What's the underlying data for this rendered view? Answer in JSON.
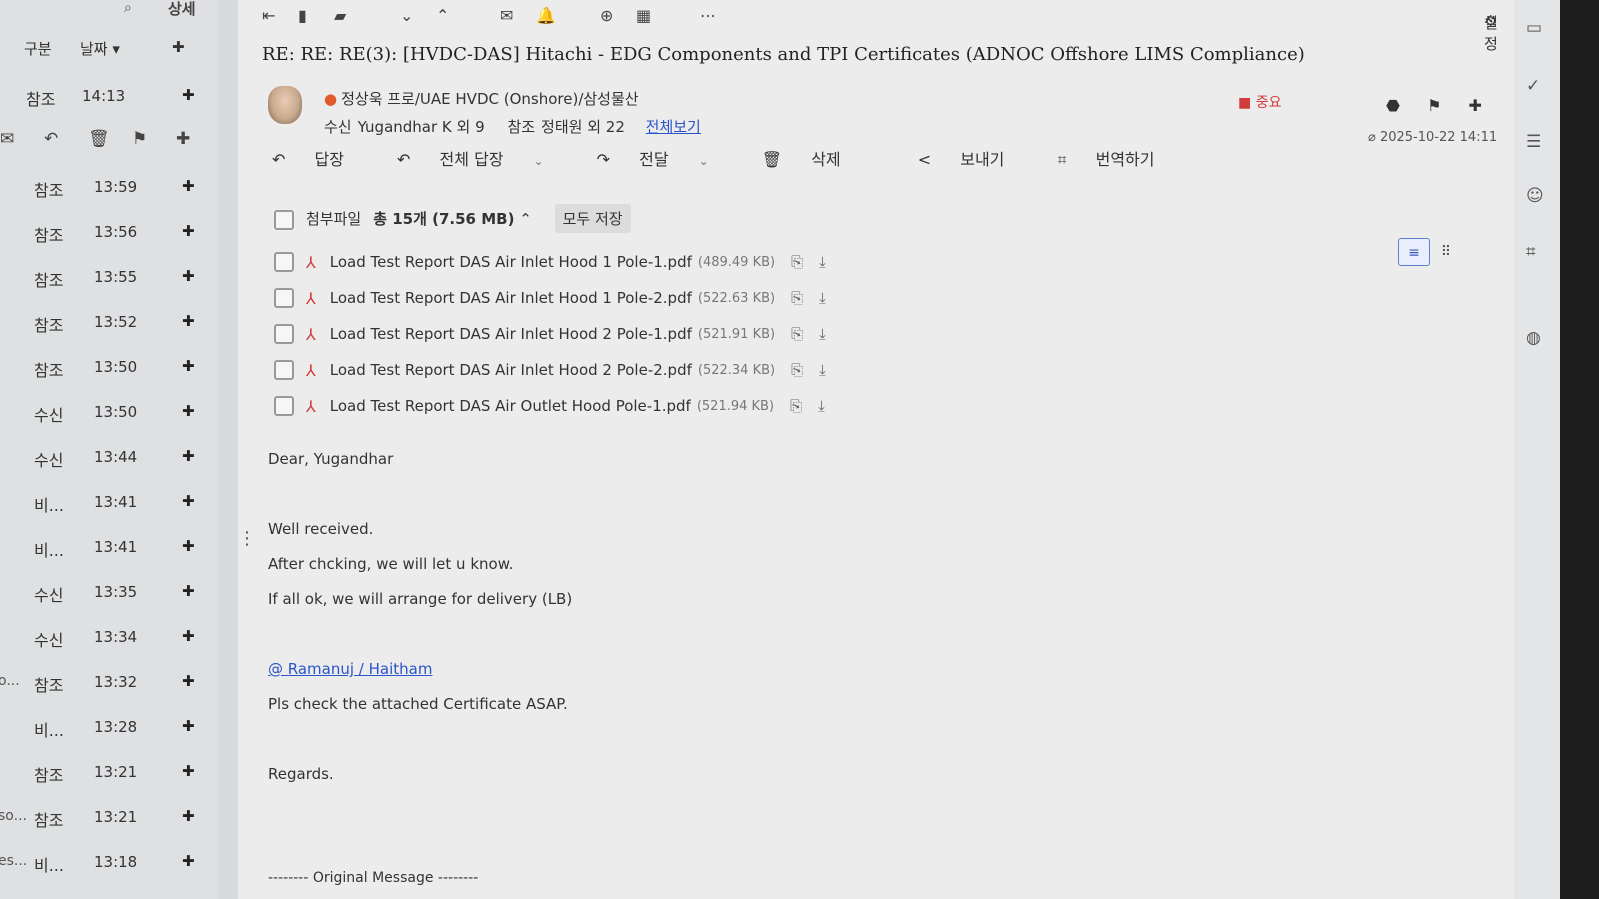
{
  "list": {
    "detail_label": "상세",
    "header": {
      "col_type": "구분",
      "col_date": "날짜",
      "sort_icon": "chevron-down"
    },
    "rows": [
      {
        "trunc": "",
        "type": "참조",
        "time": "14:13"
      },
      {
        "trunc": "",
        "type": "참조",
        "time": "13:59"
      },
      {
        "trunc": "",
        "type": "참조",
        "time": "13:56"
      },
      {
        "trunc": "",
        "type": "참조",
        "time": "13:55"
      },
      {
        "trunc": "",
        "type": "참조",
        "time": "13:52"
      },
      {
        "trunc": "",
        "type": "참조",
        "time": "13:50"
      },
      {
        "trunc": "",
        "type": "수신",
        "time": "13:50"
      },
      {
        "trunc": "",
        "type": "수신",
        "time": "13:44"
      },
      {
        "trunc": "",
        "type": "비...",
        "time": "13:41"
      },
      {
        "trunc": "",
        "type": "비...",
        "time": "13:41"
      },
      {
        "trunc": "",
        "type": "수신",
        "time": "13:35"
      },
      {
        "trunc": "",
        "type": "수신",
        "time": "13:34"
      },
      {
        "trunc": "o...",
        "type": "참조",
        "time": "13:32"
      },
      {
        "trunc": "",
        "type": "비...",
        "time": "13:28"
      },
      {
        "trunc": "",
        "type": "참조",
        "time": "13:21"
      },
      {
        "trunc": "so...",
        "type": "참조",
        "time": "13:21"
      },
      {
        "trunc": "es...",
        "type": "비...",
        "time": "13:18"
      }
    ]
  },
  "settings_label": "설정",
  "mail": {
    "subject": "RE: RE: RE(3): [HVDC-DAS] Hitachi - EDG Components and TPI Certificates (ADNOC Offshore LIMS Compliance)",
    "priority": "중요",
    "sender": "정상욱 프로/UAE HVDC (Onshore)/삼성물산",
    "to_label": "수신",
    "to_value": "Yugandhar K 외 9",
    "cc_label": "참조",
    "cc_value": "정태원 외 22",
    "view_all": "전체보기",
    "datetime": "2025-10-22 14:11",
    "actions": {
      "reply": "답장",
      "reply_all": "전체 답장",
      "forward": "전달",
      "delete": "삭제",
      "send": "보내기",
      "translate": "번역하기"
    },
    "attachments": {
      "label": "첨부파일",
      "total": "총 15개 (7.56 MB)",
      "save_all": "모두 저장",
      "items": [
        {
          "name": "Load Test Report DAS Air Inlet Hood 1 Pole-1.pdf",
          "size": "(489.49 KB)"
        },
        {
          "name": "Load Test Report DAS Air Inlet Hood 1 Pole-2.pdf",
          "size": "(522.63 KB)"
        },
        {
          "name": "Load Test Report DAS Air Inlet Hood 2 Pole-1.pdf",
          "size": "(521.91 KB)"
        },
        {
          "name": "Load Test Report DAS Air Inlet Hood 2 Pole-2.pdf",
          "size": "(522.34 KB)"
        },
        {
          "name": "Load Test Report DAS Air Outlet Hood Pole-1.pdf",
          "size": "(521.94 KB)"
        }
      ]
    },
    "body": {
      "greeting": "Dear, Yugandhar",
      "line1": "Well received.",
      "line2": "After chcking, we will let u know.",
      "line3": "If all ok, we will arrange for delivery (LB)",
      "mention": "@ Ramanuj / Haitham",
      "line4": "Pls check the attached Certificate ASAP.",
      "closing": "Regards.",
      "original": "-------- Original Message --------"
    }
  },
  "colors": {
    "accent": "#2a55c9",
    "priority": "#d23b3b",
    "pdf": "#d23b3b"
  }
}
